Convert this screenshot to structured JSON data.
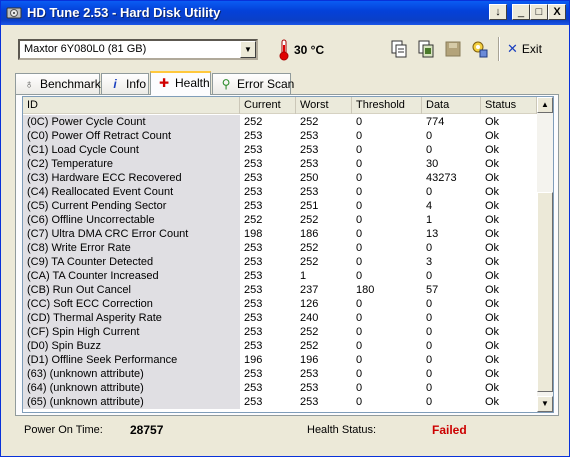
{
  "window": {
    "title": "HD Tune 2.53 - Hard Disk Utility",
    "controls": {
      "help": "↓",
      "minimize": "_",
      "maximize": "□",
      "close": "X"
    }
  },
  "toolbar": {
    "drive": "Maxtor 6Y080L0 (81 GB)",
    "temperature": "30 °C",
    "exit_label": "Exit",
    "icons": [
      "copy-text-icon",
      "copy-screenshot-icon",
      "save-icon",
      "options-icon"
    ]
  },
  "tabs": [
    {
      "label": "Benchmark",
      "icon": "benchmark-icon"
    },
    {
      "label": "Info",
      "icon": "info-icon"
    },
    {
      "label": "Health",
      "icon": "health-icon",
      "active": true
    },
    {
      "label": "Error Scan",
      "icon": "error-scan-icon"
    }
  ],
  "table": {
    "columns": [
      "ID",
      "Current",
      "Worst",
      "Threshold",
      "Data",
      "Status"
    ],
    "rows": [
      [
        "(0C) Power Cycle Count",
        "252",
        "252",
        "0",
        "774",
        "Ok"
      ],
      [
        "(C0) Power Off Retract Count",
        "253",
        "253",
        "0",
        "0",
        "Ok"
      ],
      [
        "(C1) Load Cycle Count",
        "253",
        "253",
        "0",
        "0",
        "Ok"
      ],
      [
        "(C2) Temperature",
        "253",
        "253",
        "0",
        "30",
        "Ok"
      ],
      [
        "(C3) Hardware ECC Recovered",
        "253",
        "250",
        "0",
        "43273",
        "Ok"
      ],
      [
        "(C4) Reallocated Event Count",
        "253",
        "253",
        "0",
        "0",
        "Ok"
      ],
      [
        "(C5) Current Pending Sector",
        "253",
        "251",
        "0",
        "4",
        "Ok"
      ],
      [
        "(C6) Offline Uncorrectable",
        "252",
        "252",
        "0",
        "1",
        "Ok"
      ],
      [
        "(C7) Ultra DMA CRC Error Count",
        "198",
        "186",
        "0",
        "13",
        "Ok"
      ],
      [
        "(C8) Write Error Rate",
        "253",
        "252",
        "0",
        "0",
        "Ok"
      ],
      [
        "(C9) TA Counter Detected",
        "253",
        "252",
        "0",
        "3",
        "Ok"
      ],
      [
        "(CA) TA Counter Increased",
        "253",
        "1",
        "0",
        "0",
        "Ok"
      ],
      [
        "(CB) Run Out Cancel",
        "253",
        "237",
        "180",
        "57",
        "Ok"
      ],
      [
        "(CC) Soft ECC Correction",
        "253",
        "126",
        "0",
        "0",
        "Ok"
      ],
      [
        "(CD) Thermal Asperity Rate",
        "253",
        "240",
        "0",
        "0",
        "Ok"
      ],
      [
        "(CF) Spin High Current",
        "253",
        "252",
        "0",
        "0",
        "Ok"
      ],
      [
        "(D0) Spin Buzz",
        "253",
        "252",
        "0",
        "0",
        "Ok"
      ],
      [
        "(D1) Offline Seek Performance",
        "196",
        "196",
        "0",
        "0",
        "Ok"
      ],
      [
        "(63) (unknown attribute)",
        "253",
        "253",
        "0",
        "0",
        "Ok"
      ],
      [
        "(64) (unknown attribute)",
        "253",
        "253",
        "0",
        "0",
        "Ok"
      ],
      [
        "(65) (unknown attribute)",
        "253",
        "253",
        "0",
        "0",
        "Ok"
      ]
    ]
  },
  "status": {
    "power_on_label": "Power On Time:",
    "power_on_value": "28757",
    "health_label": "Health Status:",
    "health_value": "Failed",
    "health_color": "#cc0000"
  },
  "colors": {
    "titlebar": "#0a5cf3",
    "window_bg": "#ece9d8",
    "id_column_bg": "#e0dfe3"
  }
}
